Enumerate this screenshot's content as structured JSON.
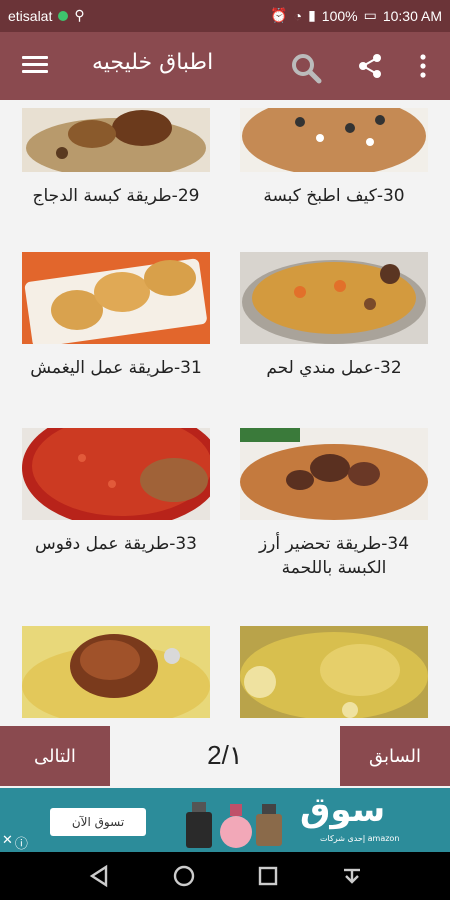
{
  "status": {
    "carrier": "etisalat",
    "battery": "100%",
    "time": "10:30 AM"
  },
  "appbar": {
    "title": "اطباق خليجيه"
  },
  "cards": [
    {
      "label": "29-طريقة كبسة الدجاج"
    },
    {
      "label": "30-كيف اطبخ كبسة"
    },
    {
      "label": "31-طريقة عمل اليغمش"
    },
    {
      "label": "32-عمل مندي لحم"
    },
    {
      "label": "33-طريقة عمل دقوس"
    },
    {
      "label": "34-طريقة تحضير أرز الكبسة باللحمة"
    },
    {
      "label": ""
    },
    {
      "label": ""
    }
  ],
  "pager": {
    "next_label": "التالى",
    "prev_label": "السابق",
    "page": "2/١"
  },
  "ad": {
    "shop_label": "تسوق الآن",
    "brand": "سوق",
    "brand_sub": "إحدى شركات amazon"
  },
  "colors": {
    "primary": "#8a4a4f",
    "statusbar": "#6b3438",
    "ad": "#2c8c9a"
  }
}
